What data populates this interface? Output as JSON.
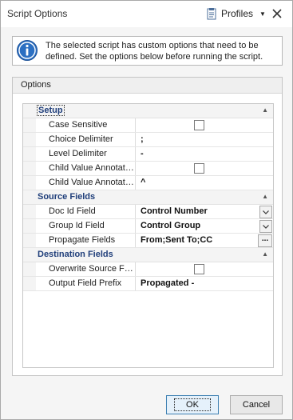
{
  "window": {
    "title": "Script Options",
    "profiles_label": "Profiles",
    "profiles_icon": "document-icon",
    "close_icon": "close-icon"
  },
  "info": {
    "icon": "info-icon",
    "message": "The selected script has custom options that need to be defined. Set the options below before running the script."
  },
  "options": {
    "header": "Options",
    "categories": [
      {
        "label": "Setup",
        "rows": [
          {
            "name": "Case Sensitive",
            "type": "checkbox",
            "checked": false
          },
          {
            "name": "Choice Delimiter",
            "type": "text",
            "value": ";"
          },
          {
            "name": "Level Delimiter",
            "type": "text",
            "value": "-"
          },
          {
            "name": "Child Value Annotation",
            "type": "checkbox",
            "checked": false
          },
          {
            "name": "Child Value Annotation ...",
            "type": "text",
            "value": "^"
          }
        ]
      },
      {
        "label": "Source Fields",
        "rows": [
          {
            "name": "Doc Id Field",
            "type": "combo",
            "value": "Control Number"
          },
          {
            "name": "Group Id Field",
            "type": "combo",
            "value": "Control Group"
          },
          {
            "name": "Propagate Fields",
            "type": "ellipsis",
            "value": "From;Sent To;CC",
            "button": "..."
          }
        ]
      },
      {
        "label": "Destination Fields",
        "rows": [
          {
            "name": "Overwrite Source Fields",
            "type": "checkbox",
            "checked": false
          },
          {
            "name": "Output Field Prefix",
            "type": "text",
            "value": "Propagated -"
          }
        ]
      }
    ]
  },
  "buttons": {
    "ok": "OK",
    "cancel": "Cancel"
  },
  "colors": {
    "category_text": "#1f3e7a",
    "info_icon": "#2b6fc2",
    "ok_border": "#3c7fb1"
  }
}
